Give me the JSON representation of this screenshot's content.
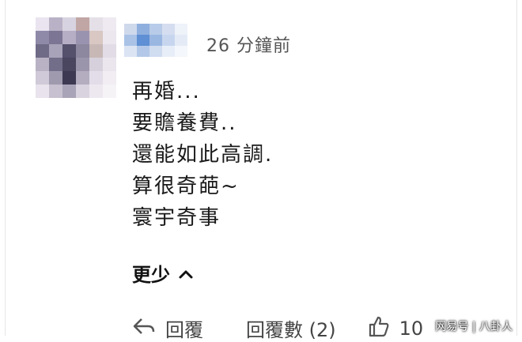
{
  "comment": {
    "timestamp": "26 分鐘前",
    "lines": [
      "再婚...",
      "要贍養費..",
      "還能如此高調.",
      "算很奇葩~",
      "寰宇奇事"
    ],
    "show_less_label": "更少"
  },
  "actions": {
    "reply_label": "回覆",
    "reply_count_label": "回覆數 (2)",
    "like_count": "10"
  },
  "watermark": "网易号 | 八卦人",
  "avatar_colors": [
    "#e9e4ef",
    "#b9b2c6",
    "#d8d3e0",
    "#c0a6a4",
    "#e5e0e8",
    "#efeaf2",
    "#8f8aa8",
    "#7c7694",
    "#b5aec4",
    "#9a93b0",
    "#d8c7c2",
    "#ece7ef",
    "#6f6a86",
    "#a9a3ba",
    "#55506c",
    "#8d879f",
    "#c7b8b6",
    "#e1dce5",
    "#b8b2c4",
    "#726d88",
    "#4a4660",
    "#9b95ab",
    "#d6d0dc",
    "#ebe6ee",
    "#cfc9d8",
    "#a09aaf",
    "#3d3952",
    "#b3adbf",
    "#e2dde8",
    "#f1edf3",
    "#e8e3ec",
    "#c6c0d0",
    "#aaa4b8",
    "#d9d3df",
    "#ede8f0",
    "#f6f3f7"
  ],
  "name_colors": [
    "#cfd9ec",
    "#8fb0de",
    "#b8cbe8",
    "#d5def0",
    "#eef2f9",
    "#a9c2e6",
    "#5f8fd4",
    "#9ab7e2",
    "#c7d6ee",
    "#e4ebf6",
    "#dbe4f3",
    "#b3c8e8",
    "#d0dcf0",
    "#e8eef8",
    "#f4f7fb"
  ]
}
